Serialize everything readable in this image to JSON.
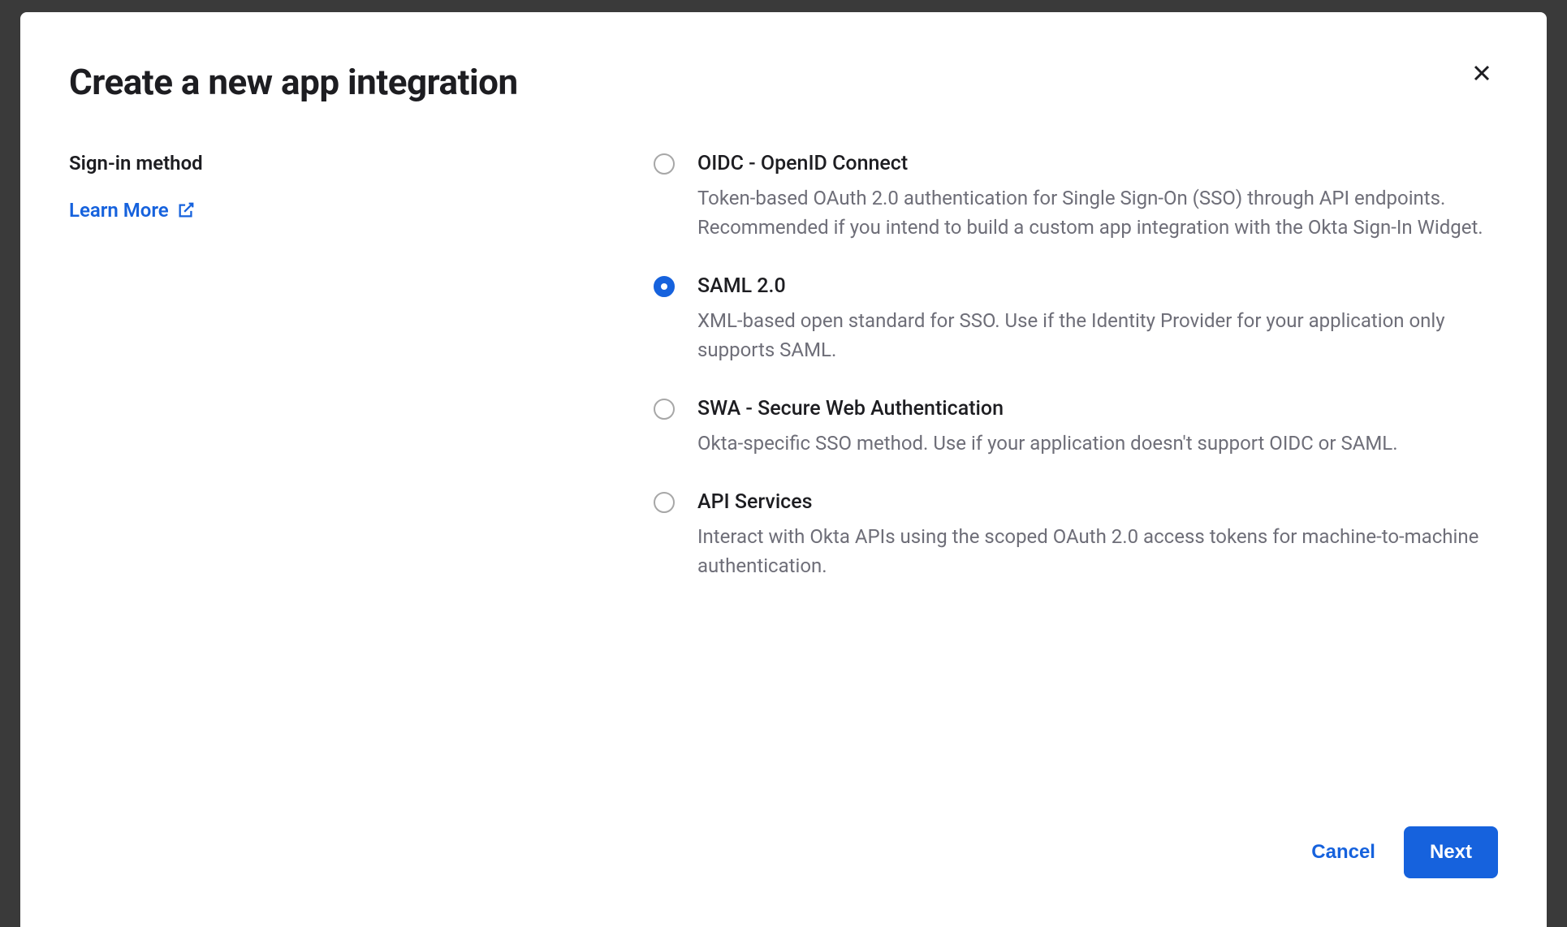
{
  "modal": {
    "title": "Create a new app integration",
    "section_label": "Sign-in method",
    "learn_more_label": "Learn More",
    "options": [
      {
        "title": "OIDC - OpenID Connect",
        "desc": "Token-based OAuth 2.0 authentication for Single Sign-On (SSO) through API endpoints. Recommended if you intend to build a custom app integration with the Okta Sign-In Widget.",
        "selected": false
      },
      {
        "title": "SAML 2.0",
        "desc": "XML-based open standard for SSO. Use if the Identity Provider for your application only supports SAML.",
        "selected": true
      },
      {
        "title": "SWA - Secure Web Authentication",
        "desc": "Okta-specific SSO method. Use if your application doesn't support OIDC or SAML.",
        "selected": false
      },
      {
        "title": "API Services",
        "desc": "Interact with Okta APIs using the scoped OAuth 2.0 access tokens for machine-to-machine authentication.",
        "selected": false
      }
    ],
    "cancel_label": "Cancel",
    "next_label": "Next"
  }
}
